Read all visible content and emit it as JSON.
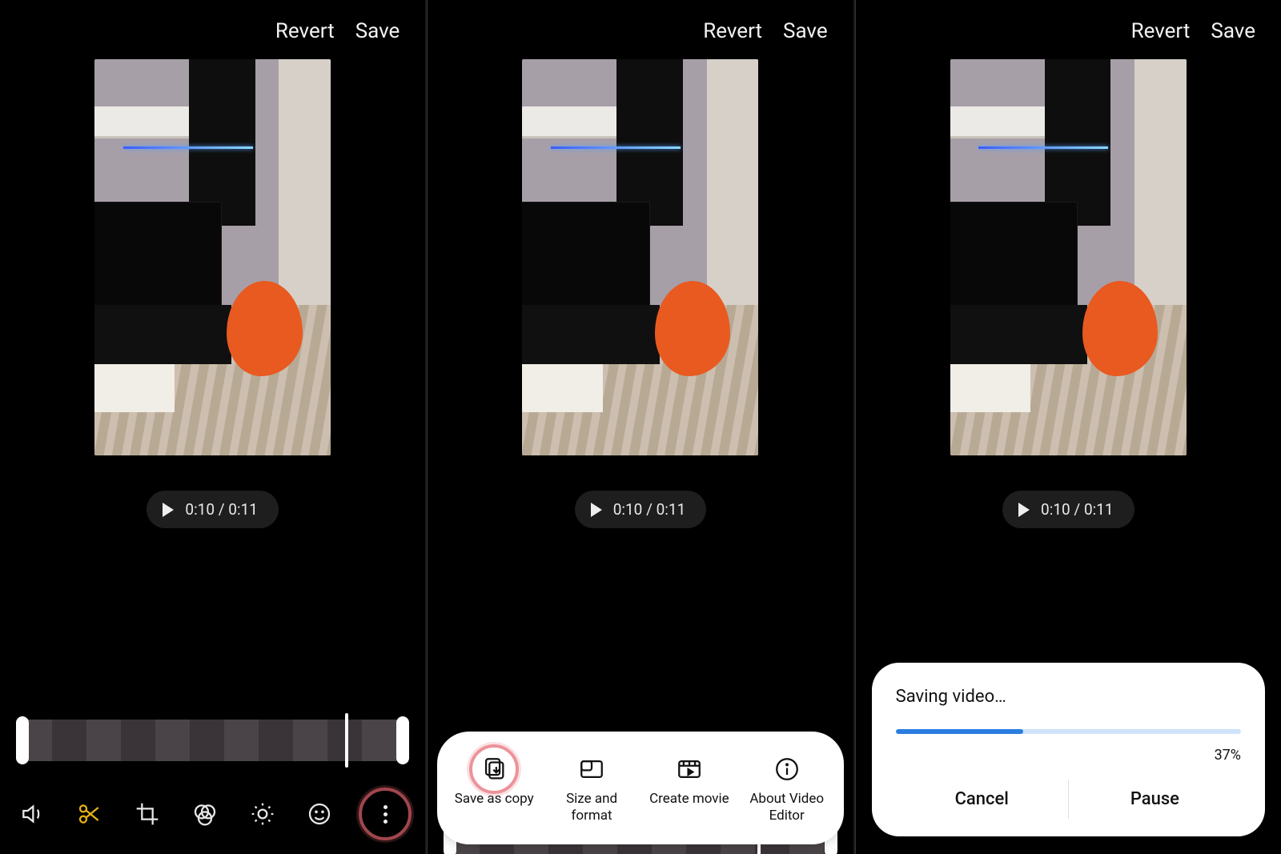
{
  "header": {
    "revert": "Revert",
    "save": "Save"
  },
  "playback": {
    "current": "0:10",
    "total": "0:11",
    "separator": " / "
  },
  "tools": {
    "volume": "volume-icon",
    "trim": "scissors-icon",
    "transform": "crop-rotate-icon",
    "filters": "filters-icon",
    "adjust": "brightness-icon",
    "decorate": "smiley-icon",
    "more": "more-icon"
  },
  "options_sheet": {
    "save_as_copy": "Save as copy",
    "size_format": "Size and format",
    "create_movie": "Create movie",
    "about": "About Video Editor"
  },
  "saving_dialog": {
    "title": "Saving video…",
    "progress_pct": 37,
    "pct_label": "37%",
    "cancel": "Cancel",
    "pause": "Pause"
  }
}
